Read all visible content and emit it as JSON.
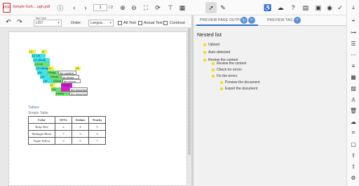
{
  "file": {
    "icon_label": "PDF",
    "name": "Simple-Gsh....ugh.pdf"
  },
  "navigation": {
    "current_page": "1",
    "total_pages": "/ 2"
  },
  "toolbar2": {
    "tag_type_label": "Tag Type",
    "tag_type_value": "LIST",
    "order_label": "Order",
    "language_value": "Langua...",
    "alt_text_label": "Alt Text",
    "actual_text_label": "Actual Text",
    "continue_label": "Continue"
  },
  "document": {
    "tags": [
      "L1",
      "LI",
      "L2 Lbl",
      "L2 LBody",
      "L3 Lbl",
      "L3 LBody",
      "LI",
      "Lbl",
      "LBody",
      "Lbl",
      "LBody",
      "Lbl",
      "LBody",
      "the content",
      "for errors",
      "the errors",
      "L3",
      "LI",
      "Lbl",
      "LBody",
      "LBody",
      "the document",
      "the document"
    ],
    "heading": "Tables",
    "subheading": "Simple Table",
    "table": {
      "headers": [
        "Color",
        "SUVs",
        "Sedans",
        "Trucks"
      ],
      "rows": [
        [
          "Ruby Red",
          "2",
          "4",
          "5"
        ],
        [
          "Midnight Black",
          "7",
          "5",
          "5"
        ],
        [
          "Triple Yellow",
          "3",
          "5",
          "7"
        ]
      ]
    }
  },
  "right_panel": {
    "tabs": [
      "PREVIEW PAGE OUTPUT",
      "PREVIEW TAG"
    ],
    "title": "Nested list",
    "list": [
      {
        "text": "Upload",
        "level": 0
      },
      {
        "text": "Auto-detected",
        "level": 0
      },
      {
        "text": "Review the content",
        "level": 0
      },
      {
        "text": "Review the content",
        "level": 1
      },
      {
        "text": "Check for errors",
        "level": 1
      },
      {
        "text": "Fix the errors",
        "level": 1
      },
      {
        "text": "Preview the document",
        "level": 2
      },
      {
        "text": "Export the document",
        "level": 2
      }
    ]
  },
  "colors": {
    "accent": "#2f6fd1",
    "bullet": "#f2dd1d",
    "file_name": "#c62828"
  },
  "icons": {
    "top_toolbar": [
      "info-icon",
      "chevron-left-icon",
      "chevron-right-icon",
      "zoom-in-icon",
      "zoom-out-icon",
      "fit-screen-icon",
      "rotate-icon",
      "align-top-icon",
      "grid-icon",
      "pointer-icon",
      "pen-icon",
      "accessibility-icon",
      "cloud-check-icon",
      "help-icon",
      "calendar-icon",
      "save-icon",
      "eye-icon",
      "check-circle-icon",
      "download-icon",
      "fullscreen-icon"
    ],
    "side": [
      "tag-tree-icon",
      "hierarchy-icon",
      "list-icon",
      "more-icon",
      "align-icon",
      "table-icon",
      "image-icon",
      "form-icon",
      "person-icon",
      "trash-icon",
      "cloud-icon",
      "crop-icon",
      "region-icon",
      "export-icon",
      "upload-icon",
      "settings-icon"
    ]
  }
}
